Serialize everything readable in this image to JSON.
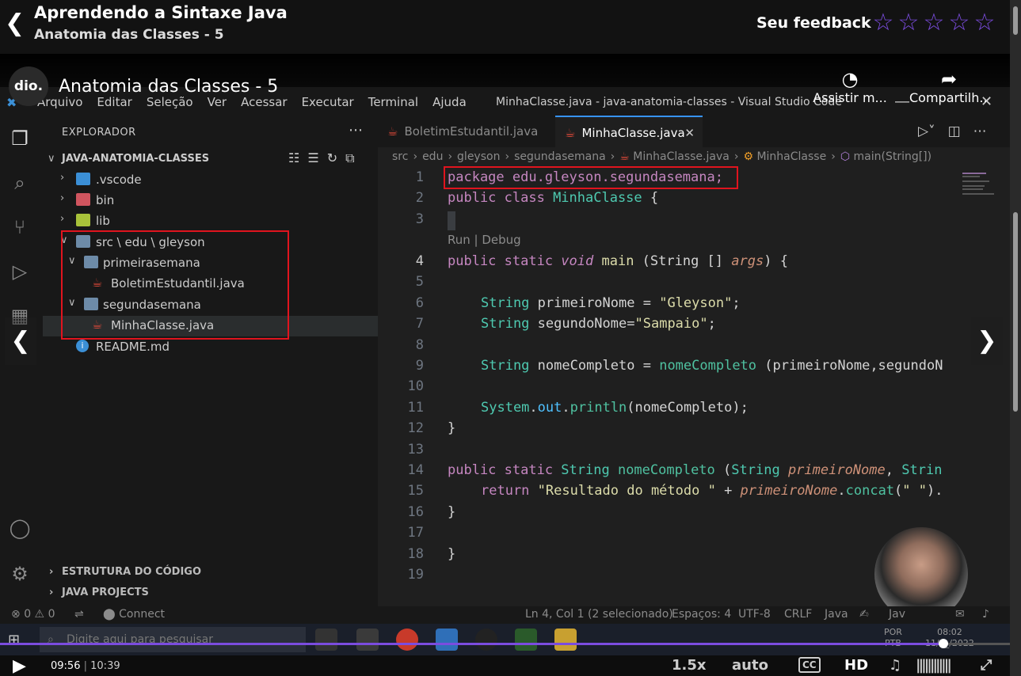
{
  "header": {
    "course_title": "Aprendendo a Sintaxe Java",
    "lesson_title": "Anatomia das Classes - 5",
    "feedback_label": "Seu feedback",
    "star_count": 5
  },
  "video_overlay": {
    "logo": "dio.",
    "title": "Anatomia das Classes - 5",
    "watch_later": "Assistir m...",
    "share": "Compartilh..."
  },
  "vscode": {
    "menu": [
      "Arquivo",
      "Editar",
      "Seleção",
      "Ver",
      "Acessar",
      "Executar",
      "Terminal",
      "Ajuda"
    ],
    "window_title": "MinhaClasse.java - java-anatomia-classes - Visual Studio Code",
    "explorer": {
      "title": "EXPLORADOR",
      "root": "JAVA-ANATOMIA-CLASSES",
      "items": [
        {
          "label": ".vscode"
        },
        {
          "label": "bin"
        },
        {
          "label": "lib"
        },
        {
          "label": "src \\ edu \\ gleyson"
        },
        {
          "label": "primeirasemana"
        },
        {
          "label": "BoletimEstudantil.java"
        },
        {
          "label": "segundasemana"
        },
        {
          "label": "MinhaClasse.java"
        },
        {
          "label": "README.md"
        }
      ],
      "sections": [
        "ESTRUTURA DO CÓDIGO",
        "JAVA PROJECTS"
      ]
    },
    "tabs": [
      {
        "label": "BoletimEstudantil.java",
        "active": false
      },
      {
        "label": "MinhaClasse.java",
        "active": true
      }
    ],
    "breadcrumb": [
      "src",
      "edu",
      "gleyson",
      "segundasemana",
      "MinhaClasse.java",
      "MinhaClasse",
      "main(String[])"
    ],
    "codelens": "Run | Debug",
    "line_numbers": [
      "1",
      "2",
      "3",
      "4",
      "5",
      "6",
      "7",
      "8",
      "9",
      "10",
      "11",
      "12",
      "13",
      "14",
      "15",
      "16",
      "17",
      "18",
      "19"
    ],
    "code": {
      "l1": "package edu.gleyson.segundasemana;",
      "l2a": "public class ",
      "l2b": "MinhaClasse",
      "l2c": " {",
      "l4a": "public static ",
      "l4b": "void",
      "l4c": " main ",
      "l4d": "(String [] ",
      "l4e": "args",
      "l4f": ") {",
      "l6a": "String",
      "l6b": " primeiroNome ",
      "l6c": "= ",
      "l6d": "\"Gleyson\"",
      "l6e": ";",
      "l7a": "String",
      "l7b": " segundoNome",
      "l7c": "=",
      "l7d": "\"Sampaio\"",
      "l7e": ";",
      "l9a": "String",
      "l9b": " nomeCompleto ",
      "l9c": "= ",
      "l9d": "nomeCompleto",
      "l9e": " (primeiroNome,segundoN",
      "l11a": "System",
      "l11b": ".",
      "l11c": "out",
      "l11d": ".",
      "l11e": "println",
      "l11f": "(nomeCompleto);",
      "l12": "}",
      "l14a": "public static ",
      "l14b": "String",
      "l14c": " nomeCompleto ",
      "l14d": "(",
      "l14e": "String",
      "l14f": " ",
      "l14g": "primeiroNome",
      "l14h": ", ",
      "l14i": "Strin",
      "l15a": "return ",
      "l15b": "\"Resultado do método \"",
      "l15c": " + ",
      "l15d": "primeiroNome",
      "l15e": ".",
      "l15f": "concat",
      "l15g": "(",
      "l15h": "\" \"",
      "l15i": ").",
      "l16": "}",
      "l18": "}"
    },
    "status": {
      "errors": "0",
      "warnings": "0",
      "connect": "Connect",
      "position": "Ln 4, Col 1 (2 selecionado)",
      "spaces": "Espaços: 4",
      "encoding": "UTF-8",
      "eol": "CRLF",
      "language": "Java",
      "extra": "Jav"
    }
  },
  "taskbar": {
    "search_placeholder": "Digite aqui para pesquisar",
    "lang": "POR",
    "lang2": "PTB",
    "time": "08:02",
    "date": "11/0_/2022"
  },
  "player": {
    "current_time": "09:56",
    "separator": "|",
    "duration": "10:39",
    "progress": 0.934,
    "speed": "1.5x",
    "quality": "auto",
    "cc": "CC",
    "hd": "HD"
  }
}
